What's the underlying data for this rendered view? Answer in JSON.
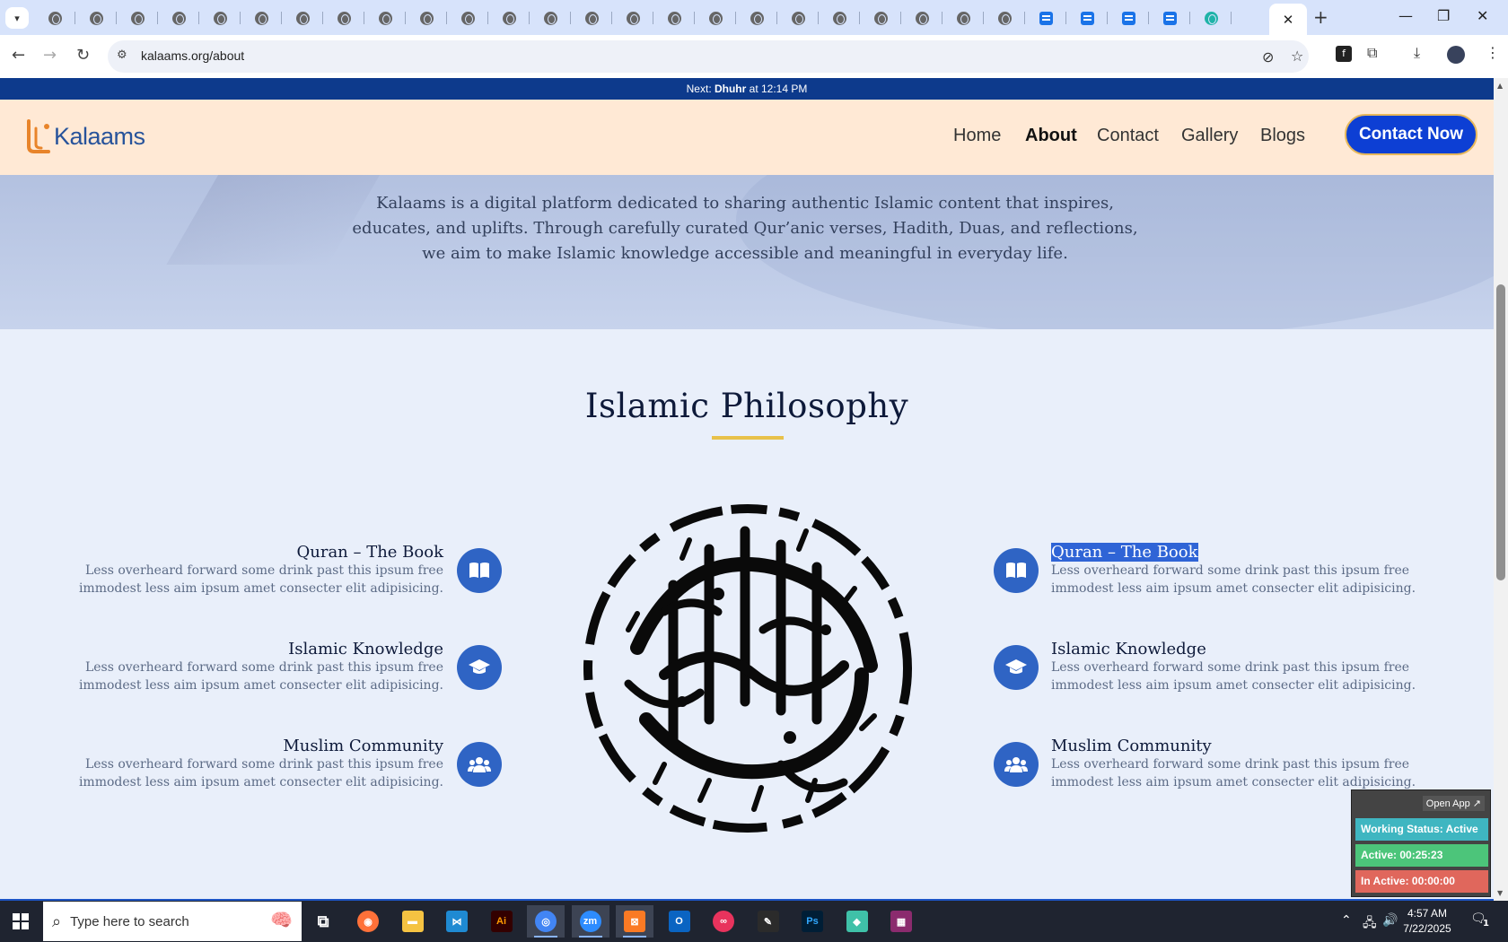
{
  "browser": {
    "tab_count_icons": 30,
    "active_tab_close": "✕",
    "new_tab": "+",
    "url": "kalaams.org/about",
    "window_controls": {
      "minimize": "—",
      "restore": "❐",
      "close": "✕"
    }
  },
  "page": {
    "prayer_bar": {
      "prefix": "Next: ",
      "prayer": "Dhuhr",
      "suffix": " at 12:14 PM"
    },
    "logo_text": "Kalaams",
    "nav": [
      "Home",
      "About",
      "Contact",
      "Gallery",
      "Blogs"
    ],
    "nav_active": "About",
    "cta_label": "Contact Now",
    "hero_text": "Kalaams is a digital platform dedicated to sharing authentic Islamic content that inspires, educates, and uplifts. Through carefully curated Qur’anic verses, Hadith, Duas, and reflections, we aim to make Islamic knowledge accessible and meaningful in everyday life.",
    "section_title": "Islamic Philosophy",
    "features_left": [
      {
        "title": "Quran – The Book",
        "text": "Less overheard forward some drink past this ipsum free immodest less aim ipsum amet consecter elit adipisicing.",
        "icon": "book-icon"
      },
      {
        "title": "Islamic Knowledge",
        "text": "Less overheard forward some drink past this ipsum free immodest less aim ipsum amet consecter elit adipisicing.",
        "icon": "graduation-cap-icon"
      },
      {
        "title": "Muslim Community",
        "text": "Less overheard forward some drink past this ipsum free immodest less aim ipsum amet consecter elit adipisicing.",
        "icon": "users-icon"
      }
    ],
    "features_right": [
      {
        "title": "Quran – The Book",
        "text": "Less overheard forward some drink past this ipsum free immodest less aim ipsum amet consecter elit adipisicing.",
        "icon": "book-icon"
      },
      {
        "title": "Islamic Knowledge",
        "text": "Less overheard forward some drink past this ipsum free immodest less aim ipsum amet consecter elit adipisicing.",
        "icon": "graduation-cap-icon"
      },
      {
        "title": "Muslim Community",
        "text": "Less overheard forward some drink past this ipsum free immodest less aim ipsum amet consecter elit adipisicing.",
        "icon": "users-icon"
      }
    ]
  },
  "tracker": {
    "open_app": "Open App ↗",
    "working_status": "Working Status: Active",
    "active": "Active: 00:25:23",
    "inactive": "In Active: 00:00:00",
    "colors": {
      "status": "#3fb6c1",
      "active": "#4cc57a",
      "inactive": "#e0675c"
    }
  },
  "taskbar": {
    "search_placeholder": "Type here to search",
    "apps": [
      "Firefox",
      "File Explorer",
      "VS Code",
      "Illustrator",
      "Chrome",
      "Zoom",
      "XAMPP",
      "Outlook",
      "Creative Cloud",
      "Pen Tool",
      "Photoshop",
      "Gem App",
      "WinRAR"
    ],
    "clock_time": "4:57 AM",
    "clock_date": "7/22/2025",
    "notification_count": "1"
  },
  "colors": {
    "brand_blue": "#0d3fd4",
    "header_bg": "#ffe9d5",
    "accent_gold": "#e8c14a",
    "icon_circle": "#2f64c4"
  }
}
